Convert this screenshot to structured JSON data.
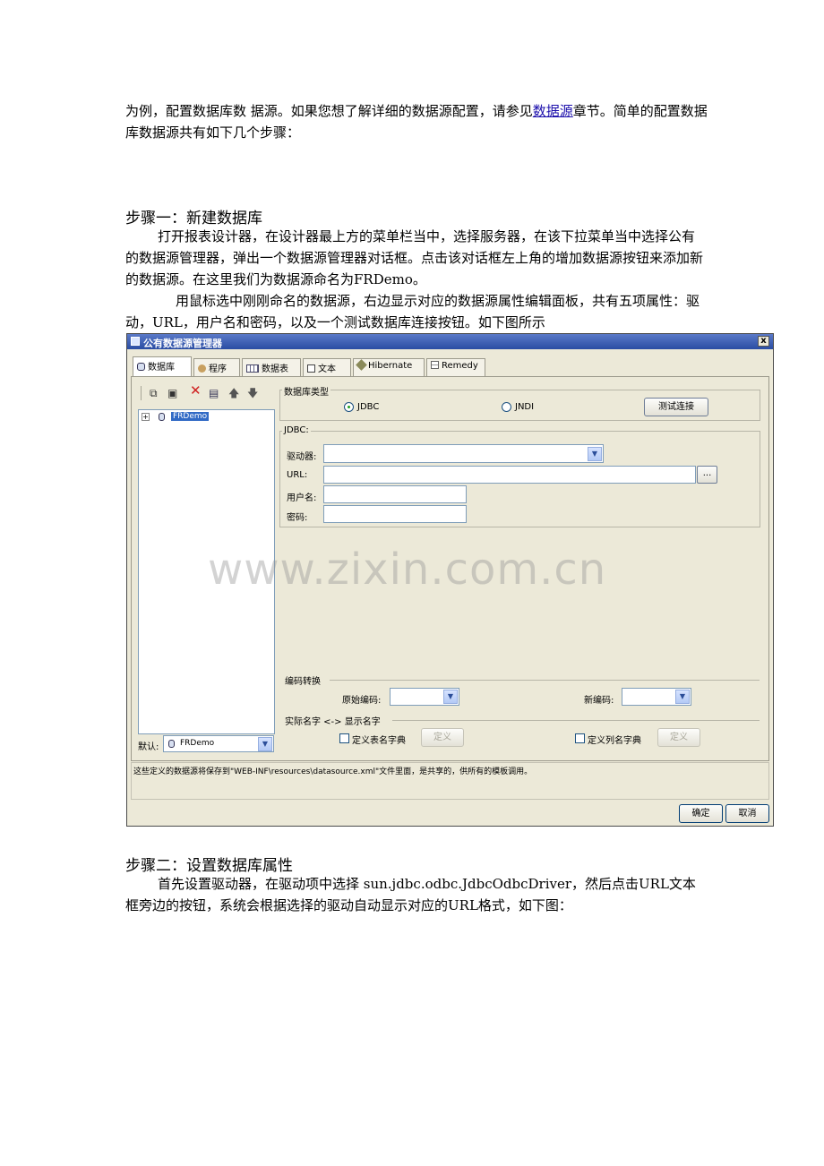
{
  "doc": {
    "para1_a": "为例，配置数据库数 据源。如果您想了解详细的数据源配置，请参见",
    "para1_link": "数据源",
    "para1_b": "章节。简单的配置数据库数据源共有如下几个步骤：",
    "step1_title": "步骤一：新建数据库",
    "step1_p1": "打开报表设计器，在设计器最上方的菜单栏当中，选择服务器，在该下拉菜单当中选择公有的数据源管理器，弹出一个数据源管理器对话框。点击该对话框左上角的增加数据源按钮来添加新的数据源。在这里我们为数据源命名为FRDemo。",
    "step1_p2": "用鼠标选中刚刚命名的数据源，右边显示对应的数据源属性编辑面板，共有五项属性：驱动，URL，用户名和密码，以及一个测试数据库连接按钮。如下图所示",
    "step2_title": "步骤二：设置数据库属性",
    "step2_p1": "首先设置驱动器，在驱动项中选择 sun.jdbc.odbc.JdbcOdbcDriver，然后点击URL文本框旁边的按钮，系统会根据选择的驱动自动显示对应的URL格式，如下图："
  },
  "dialog": {
    "title": "公有数据源管理器",
    "close": "x",
    "tabs": [
      "数据库",
      "程序",
      "数据表",
      "文本",
      "Hibernate",
      "Remedy"
    ],
    "tree_item": "FRDemo",
    "tree_expand": "+",
    "db_type_label": "数据库类型",
    "radio_jdbc": "JDBC",
    "radio_jndi": "JNDI",
    "test_button": "测试连接",
    "jdbc_group": "JDBC:",
    "driver_label": "驱动器:",
    "url_label": "URL:",
    "url_button": "...",
    "user_label": "用户名:",
    "password_label": "密码:",
    "encoding_group": "编码转换",
    "orig_encoding_label": "原始编码:",
    "new_encoding_label": "新编码:",
    "naming_group": "实际名字 <-> 显示名字",
    "table_dict_label": "定义表名字典",
    "column_dict_label": "定义列名字典",
    "define_button": "定义",
    "default_label": "默认:",
    "default_value": "FRDemo",
    "info_text": "这些定义的数据源将保存到\"WEB-INF\\resources\\datasource.xml\"文件里面，是共享的，供所有的模板调用。",
    "ok_button": "确定",
    "cancel_button": "取消"
  },
  "watermark": "www.zixin.com.cn"
}
